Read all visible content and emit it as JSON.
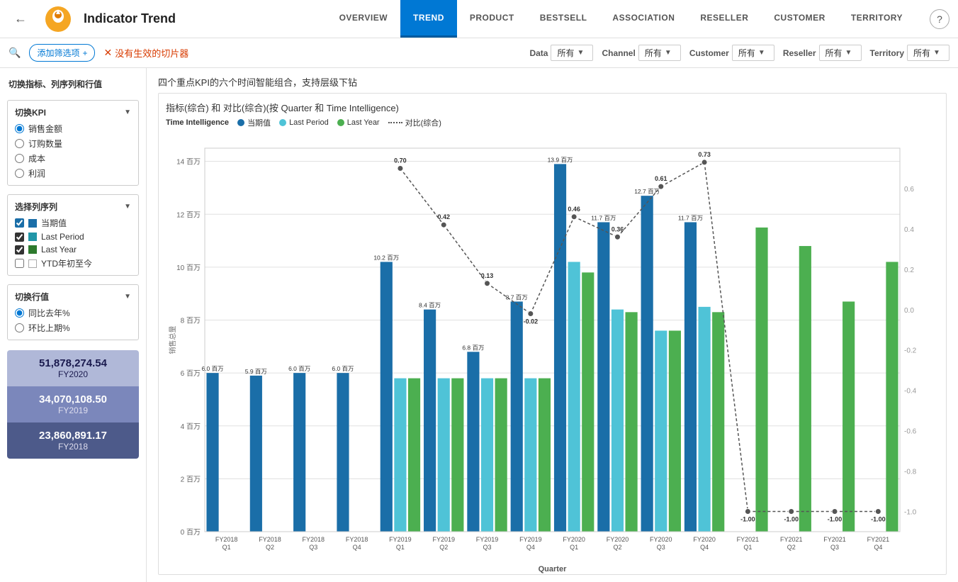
{
  "header": {
    "back_label": "←",
    "title": "Indicator Trend",
    "nav_tabs": [
      {
        "id": "overview",
        "label": "OVERVIEW",
        "active": false
      },
      {
        "id": "trend",
        "label": "TREND",
        "active": true
      },
      {
        "id": "product",
        "label": "PRODUCT",
        "active": false
      },
      {
        "id": "bestsell",
        "label": "BESTSELL",
        "active": false
      },
      {
        "id": "association",
        "label": "ASSOCIATION",
        "active": false
      },
      {
        "id": "reseller",
        "label": "RESELLER",
        "active": false
      },
      {
        "id": "customer",
        "label": "CUSTOMER",
        "active": false
      },
      {
        "id": "territory",
        "label": "TERRITORY",
        "active": false
      }
    ],
    "help_label": "?"
  },
  "filter_bar": {
    "add_filter_label": "添加筛选项",
    "add_filter_plus": "+",
    "no_slicer_label": "没有生效的切片器",
    "filters": [
      {
        "label": "Data",
        "value": "所有"
      },
      {
        "label": "Channel",
        "value": "所有"
      },
      {
        "label": "Customer",
        "value": "所有"
      },
      {
        "label": "Reseller",
        "value": "所有"
      },
      {
        "label": "Territory",
        "value": "所有"
      }
    ]
  },
  "sidebar": {
    "title": "切换指标、列序列和行值",
    "kpi_section": {
      "label": "切换KPI",
      "options": [
        {
          "id": "sales",
          "label": "销售金额",
          "checked": true
        },
        {
          "id": "orders",
          "label": "订购数量",
          "checked": false
        },
        {
          "id": "cost",
          "label": "成本",
          "checked": false
        },
        {
          "id": "profit",
          "label": "利润",
          "checked": false
        }
      ]
    },
    "series_section": {
      "label": "选择列序列",
      "options": [
        {
          "id": "current",
          "label": "当期值",
          "color": "#1a6ea8",
          "checked": true
        },
        {
          "id": "last_period",
          "label": "Last Period",
          "color": "#2196a8",
          "checked": true
        },
        {
          "id": "last_year",
          "label": "Last Year",
          "color": "#2d7a2d",
          "checked": true
        },
        {
          "id": "ytd",
          "label": "YTD年初至今",
          "color": "#fff",
          "checked": false,
          "border": "#aaa"
        }
      ]
    },
    "value_section": {
      "label": "切换行值",
      "options": [
        {
          "id": "yoy",
          "label": "同比去年%",
          "checked": true
        },
        {
          "id": "mom",
          "label": "环比上期%",
          "checked": false
        }
      ]
    },
    "summary_cards": [
      {
        "amount": "51,878,274.54",
        "year": "FY2020",
        "class": "fy2020"
      },
      {
        "amount": "34,070,108.50",
        "year": "FY2019",
        "class": "fy2019"
      },
      {
        "amount": "23,860,891.17",
        "year": "FY2018",
        "class": "fy2018"
      }
    ]
  },
  "chart": {
    "area_title": "四个重点KPI的六个时间智能组合，支持层级下钻",
    "box_title": "指标(综合) 和 对比(综合)(按 Quarter 和 Time Intelligence)",
    "legend_items": [
      {
        "label": "Time Intelligence",
        "type": "text"
      },
      {
        "label": "当期值",
        "color": "#1a6ea8",
        "type": "dot"
      },
      {
        "label": "Last Period",
        "color": "#4fc3d7",
        "type": "dot"
      },
      {
        "label": "Last Year",
        "color": "#4caf50",
        "type": "dot"
      },
      {
        "label": "对比(综合)",
        "color": "#555",
        "type": "dashed-line"
      }
    ],
    "x_label": "Quarter",
    "y_left_label": "销售总量",
    "quarters": [
      "FY2018\nQ1",
      "FY2018\nQ2",
      "FY2018\nQ3",
      "FY2018\nQ4",
      "FY2019\nQ1",
      "FY2019\nQ2",
      "FY2019\nQ3",
      "FY2019\nQ4",
      "FY2020\nQ1",
      "FY2020\nQ2",
      "FY2020\nQ3",
      "FY2020\nQ4",
      "FY2021\nQ1",
      "FY2021\nQ2",
      "FY2021\nQ3",
      "FY2021\nQ4"
    ],
    "bars": [
      {
        "q": "FY2018 Q1",
        "current": 6.0,
        "lastPeriod": 0,
        "lastYear": 0,
        "ratio": null,
        "label_c": "6.0 百万",
        "label_lp": null,
        "label_ly": null
      },
      {
        "q": "FY2018 Q2",
        "current": 5.9,
        "lastPeriod": 0,
        "lastYear": 0,
        "ratio": null,
        "label_c": "5.9 百万",
        "label_lp": null,
        "label_ly": null
      },
      {
        "q": "FY2018 Q3",
        "current": 6.0,
        "lastPeriod": 0,
        "lastYear": 0,
        "ratio": null,
        "label_c": "6.0 百万",
        "label_lp": null,
        "label_ly": null
      },
      {
        "q": "FY2018 Q4",
        "current": 6.0,
        "lastPeriod": 0,
        "lastYear": 0,
        "ratio": null,
        "label_c": "6.0 百万",
        "label_lp": null,
        "label_ly": null
      },
      {
        "q": "FY2019 Q1",
        "current": 10.2,
        "lastPeriod": 5.8,
        "lastYear": 5.8,
        "ratio": 0.7,
        "label_c": "10.2 百万",
        "label_lp": null,
        "label_ly": null
      },
      {
        "q": "FY2019 Q2",
        "current": 8.4,
        "lastPeriod": 5.8,
        "lastYear": 5.8,
        "ratio": 0.42,
        "label_c": "8.4 百万",
        "label_lp": null,
        "label_ly": null
      },
      {
        "q": "FY2019 Q3",
        "current": 6.8,
        "lastPeriod": 5.8,
        "lastYear": 5.8,
        "ratio": 0.13,
        "label_c": "6.8 百万",
        "label_lp": null,
        "label_ly": null
      },
      {
        "q": "FY2019 Q4",
        "current": 8.7,
        "lastPeriod": 5.8,
        "lastYear": 5.8,
        "ratio": -0.02,
        "label_c": "8.7 百万",
        "label_lp": null,
        "label_ly": null
      },
      {
        "q": "FY2020 Q1",
        "current": 13.9,
        "lastPeriod": 10.2,
        "lastYear": 9.8,
        "ratio": 0.46,
        "label_c": "13.9 百万",
        "label_lp": null,
        "label_ly": null
      },
      {
        "q": "FY2020 Q2",
        "current": 11.7,
        "lastPeriod": 8.4,
        "lastYear": 8.3,
        "ratio": 0.36,
        "label_c": "11.7 百万",
        "label_lp": null,
        "label_ly": null
      },
      {
        "q": "FY2020 Q3",
        "current": 12.7,
        "lastPeriod": 7.6,
        "lastYear": 7.6,
        "ratio": 0.61,
        "label_c": "12.7 百万",
        "label_lp": null,
        "label_ly": null
      },
      {
        "q": "FY2020 Q4",
        "current": 11.7,
        "lastPeriod": 8.5,
        "lastYear": 8.3,
        "ratio": 0.73,
        "label_c": "11.7 百万",
        "label_lp": null,
        "label_ly": null
      },
      {
        "q": "FY2021 Q1",
        "current": 0,
        "lastPeriod": 0,
        "lastYear": 11.5,
        "ratio": -1.0,
        "label_c": null,
        "label_lp": null,
        "label_ly": null
      },
      {
        "q": "FY2021 Q2",
        "current": 0,
        "lastPeriod": 0,
        "lastYear": 10.8,
        "ratio": -1.0,
        "label_c": null,
        "label_lp": null,
        "label_ly": null
      },
      {
        "q": "FY2021 Q3",
        "current": 0,
        "lastPeriod": 0,
        "lastYear": 8.7,
        "ratio": -1.0,
        "label_c": null,
        "label_lp": null,
        "label_ly": null
      },
      {
        "q": "FY2021 Q4",
        "current": 0,
        "lastPeriod": 0,
        "lastYear": 10.2,
        "ratio": -1.0,
        "label_c": null,
        "label_lp": null,
        "label_ly": null
      }
    ]
  },
  "colors": {
    "current": "#1a6ea8",
    "lastPeriod": "#4fc3d7",
    "lastYear": "#4caf50",
    "ratio_positive": "#333",
    "ratio_negative": "#888",
    "accent": "#0078d4"
  }
}
